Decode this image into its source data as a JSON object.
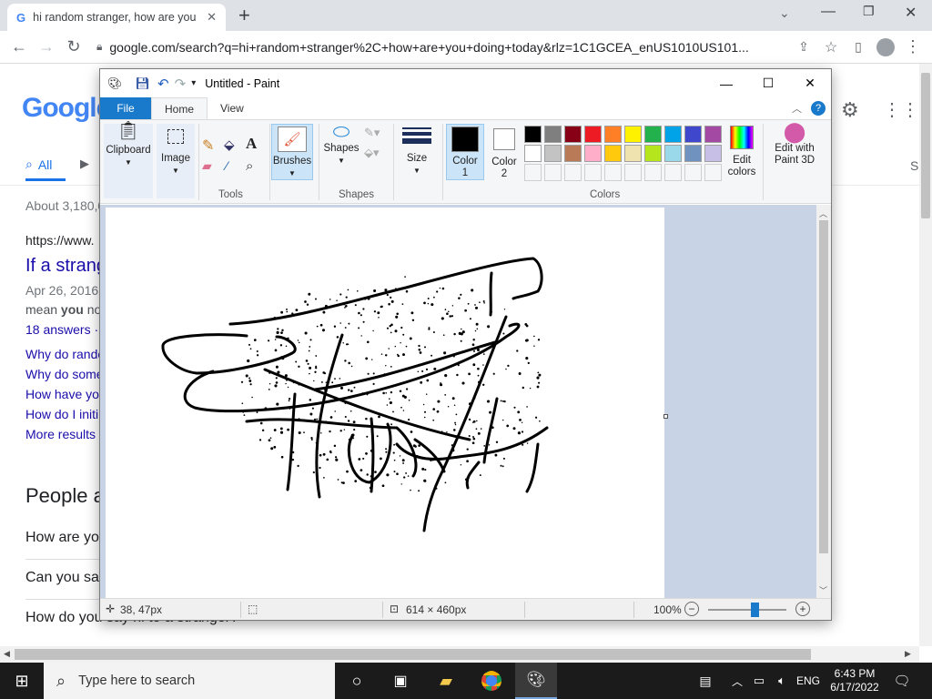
{
  "browser": {
    "tab_title": "hi random stranger, how are you",
    "new_tab": "+",
    "url": "google.com/search?q=hi+random+stranger%2C+how+are+you+doing+today&rlz=1C1GCEA_enUS1010US101..."
  },
  "google": {
    "logo": "Google",
    "tab_all": "All",
    "about": "About 3,180,0",
    "result_url": "https://www.",
    "result_title": "If a strang",
    "result_date": "Apr 26, 2016",
    "result_snippet_pre": "mean ",
    "result_snippet_bold": "you",
    "result_snippet_post": " no",
    "answers": "18 answers ·",
    "related": [
      "Why do rando",
      "Why do some",
      "How have yo",
      "How do I initi"
    ],
    "more_results": "More results",
    "people_also_ask": "People a",
    "paa": [
      "How are yo",
      "Can you say",
      "How do you say hi to a stranger?"
    ],
    "right_tab": "S"
  },
  "paint": {
    "title": "Untitled - Paint",
    "tab_file": "File",
    "tab_home": "Home",
    "tab_view": "View",
    "clipboard": "Clipboard",
    "image": "Image",
    "tools": "Tools",
    "brushes": "Brushes",
    "shapes": "Shapes",
    "shapes_group": "Shapes",
    "size": "Size",
    "color1_a": "Color",
    "color1_b": "1",
    "color2_a": "Color",
    "color2_b": "2",
    "colors_group": "Colors",
    "edit_colors_a": "Edit",
    "edit_colors_b": "colors",
    "paint3d_a": "Edit with",
    "paint3d_b": "Paint 3D",
    "palette_row1": [
      "#000000",
      "#7f7f7f",
      "#880015",
      "#ed1c24",
      "#ff7f27",
      "#fff200",
      "#22b14c",
      "#00a2e8",
      "#3f48cc",
      "#a349a4"
    ],
    "palette_row2": [
      "#ffffff",
      "#c3c3c3",
      "#b97a57",
      "#ffaec9",
      "#ffc90e",
      "#efe4b0",
      "#b5e61d",
      "#99d9ea",
      "#7092be",
      "#c8bfe7"
    ],
    "status_pos": "38, 47px",
    "status_size": "614 × 460px",
    "zoom": "100%",
    "zoom_fraction": 0.55
  },
  "taskbar": {
    "search_placeholder": "Type here to search",
    "lang": "ENG",
    "time": "6:43 PM",
    "date": "6/17/2022"
  }
}
